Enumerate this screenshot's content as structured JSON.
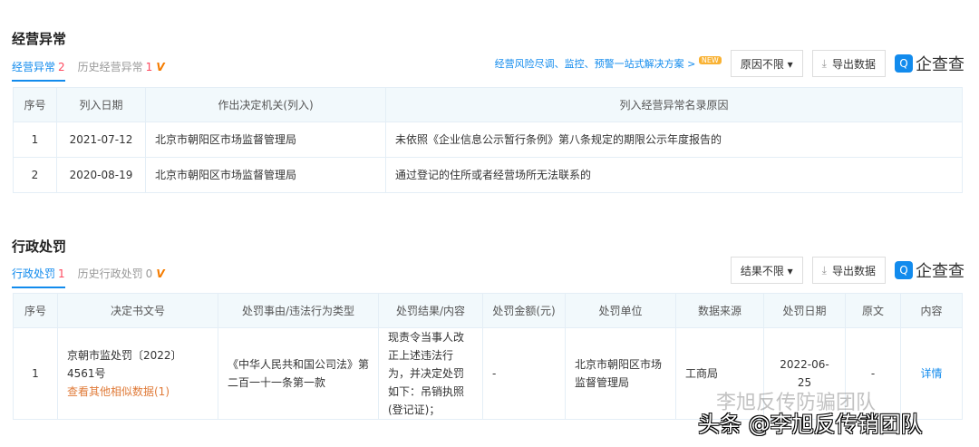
{
  "s1": {
    "title": "经营异常",
    "tab_active": "经营异常",
    "tab_active_count": "2",
    "tab_history": "历史经营异常",
    "tab_history_count": "1",
    "vip": "V",
    "promo": "经营风险尽调、监控、预警一站式解决方案 >",
    "new": "NEW",
    "filter": "原因不限 ▾",
    "export": "导出数据",
    "logo": "企查查",
    "headers": [
      "序号",
      "列入日期",
      "作出决定机关(列入)",
      "列入经营异常名录原因"
    ],
    "rows": [
      [
        "1",
        "2021-07-12",
        "北京市朝阳区市场监督管理局",
        "未依照《企业信息公示暂行条例》第八条规定的期限公示年度报告的"
      ],
      [
        "2",
        "2020-08-19",
        "北京市朝阳区市场监督管理局",
        "通过登记的住所或者经营场所无法联系的"
      ]
    ]
  },
  "s2": {
    "title": "行政处罚",
    "tab_active": "行政处罚",
    "tab_active_count": "1",
    "tab_history": "历史行政处罚",
    "tab_history_count": "0",
    "vip": "V",
    "filter": "结果不限 ▾",
    "export": "导出数据",
    "logo": "企查查",
    "headers": [
      "序号",
      "决定书文号",
      "处罚事由/违法行为类型",
      "处罚结果/内容",
      "处罚金额(元)",
      "处罚单位",
      "数据来源",
      "处罚日期",
      "原文",
      "内容"
    ],
    "row": {
      "no": "1",
      "doc": "京朝市监处罚〔2022〕4561号",
      "similar": "查看其他相似数据(1)",
      "reason": "《中华人民共和国公司法》第二百一十一条第一款",
      "result": "现责令当事人改正上述违法行为，并决定处罚如下：吊销执照(登记证)；",
      "amount": "-",
      "unit": "北京市朝阳区市场监督管理局",
      "source": "工商局",
      "date": "2022-06-25",
      "original": "-",
      "detail": "详情"
    }
  },
  "watermark": {
    "line1": "李旭反传防骗团队",
    "line2": "头条 @李旭反传销团队"
  }
}
